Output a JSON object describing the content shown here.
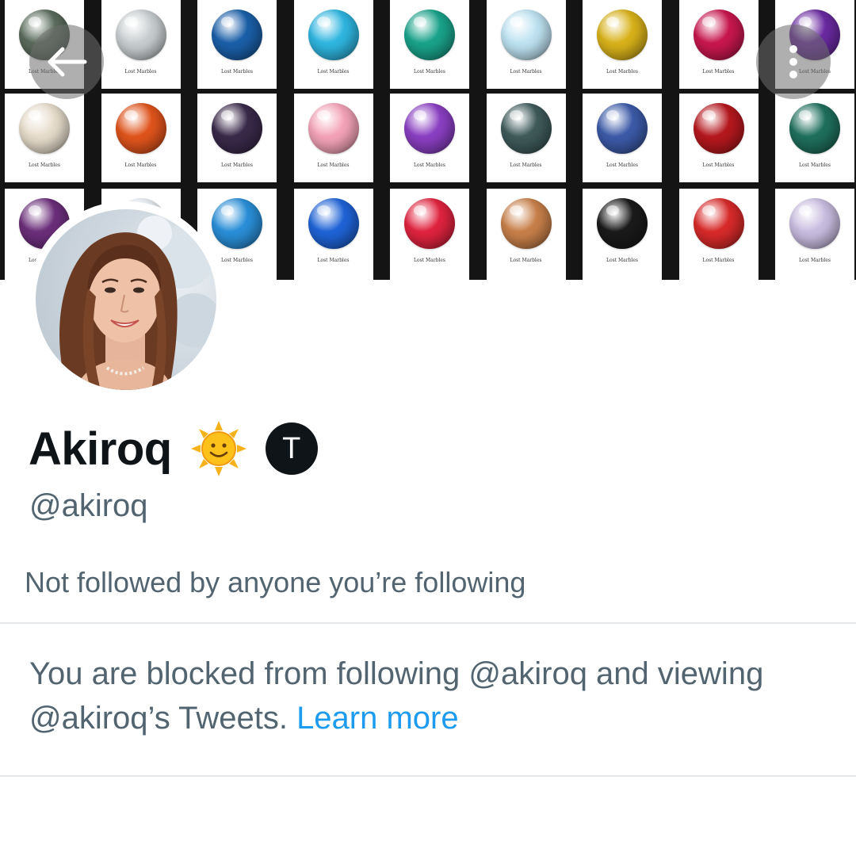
{
  "header": {
    "back_icon": "arrow-left-icon",
    "more_icon": "more-vertical-icon",
    "banner": {
      "card_caption": "Lost Marbles",
      "marble_colors": [
        [
          "#5a6b5c",
          "#c9ced0",
          "#1b5fa8",
          "#2fb6e0",
          "#1aa38a",
          "#bfe3f2",
          "#d8b21a",
          "#c8174f",
          "#6a2aa0"
        ],
        [
          "#e6dccb",
          "#e0541c",
          "#3a2a4a",
          "#f4a3b8",
          "#8a3fc2",
          "#3f5a5a",
          "#3c5aa8",
          "#b5181e",
          "#1f6f5c"
        ],
        [
          "#6b2e7a",
          "#e9eef3",
          "#2a8fd8",
          "#1f63d6",
          "#e0233f",
          "#c8804a",
          "#1a1a1a",
          "#d82a2a",
          "#c9bde0"
        ]
      ]
    }
  },
  "profile": {
    "display_name": "Akiroq",
    "emoji_icon": "sun-with-face-icon",
    "badge_letter": "T",
    "handle": "@akiroq",
    "followed_by": "Not followed by anyone you’re following"
  },
  "blocked": {
    "message": "You are blocked from following @akiroq and viewing @akiroq’s Tweets.",
    "learn_more": "Learn more"
  }
}
